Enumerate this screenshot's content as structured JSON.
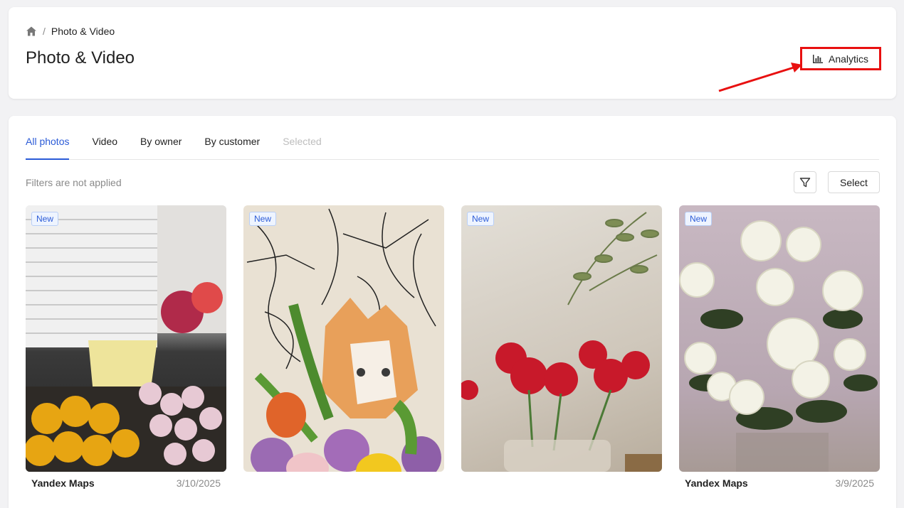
{
  "breadcrumb": {
    "current": "Photo & Video",
    "separator": "/"
  },
  "page_title": "Photo & Video",
  "analytics_button": {
    "label": "Analytics"
  },
  "tabs": [
    {
      "label": "All photos",
      "state": "active"
    },
    {
      "label": "Video",
      "state": "normal"
    },
    {
      "label": "By owner",
      "state": "normal"
    },
    {
      "label": "By customer",
      "state": "normal"
    },
    {
      "label": "Selected",
      "state": "disabled"
    }
  ],
  "filters_status": "Filters are not applied",
  "select_button": {
    "label": "Select"
  },
  "photos": [
    {
      "badge": "New",
      "owner": "Yandex Maps",
      "date": "3/10/2025"
    },
    {
      "badge": "New",
      "owner": "",
      "date": ""
    },
    {
      "badge": "New",
      "owner": "",
      "date": ""
    },
    {
      "badge": "New",
      "owner": "Yandex Maps",
      "date": "3/9/2025"
    }
  ],
  "colors": {
    "accent": "#2b5bd7",
    "annotation": "#e81010"
  }
}
